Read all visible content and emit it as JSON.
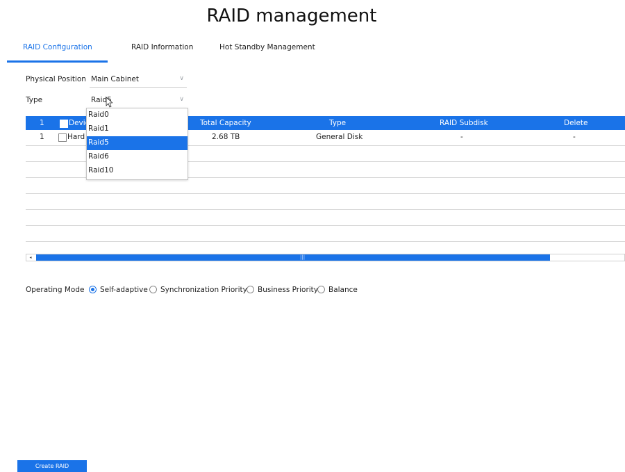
{
  "page_title": "RAID management",
  "tabs": [
    {
      "label": "RAID Configuration",
      "active": true
    },
    {
      "label": "RAID Information",
      "active": false
    },
    {
      "label": "Hot Standby Management",
      "active": false
    }
  ],
  "form": {
    "physical_position": {
      "label": "Physical Position",
      "value": "Main Cabinet"
    },
    "type": {
      "label": "Type",
      "value": "Raid5"
    }
  },
  "type_dropdown": {
    "options": [
      "Raid0",
      "Raid1",
      "Raid5",
      "Raid6",
      "Raid10"
    ],
    "selected": "Raid5"
  },
  "table": {
    "header": {
      "index": "1",
      "device": "Devic",
      "total_capacity": "Total Capacity",
      "type": "Type",
      "raid_subdisk": "RAID Subdisk",
      "delete": "Delete"
    },
    "rows": [
      {
        "index": "1",
        "device": "Hard",
        "total_capacity": "2.68 TB",
        "type": "General Disk",
        "raid_subdisk": "-",
        "delete": "-"
      }
    ],
    "scroll_left_icon": "◂",
    "scroll_grip": "|||"
  },
  "operating_mode": {
    "label": "Operating Mode",
    "options": [
      {
        "label": "Self-adaptive",
        "checked": true
      },
      {
        "label": "Synchronization Priority",
        "checked": false
      },
      {
        "label": "Business Priority",
        "checked": false
      },
      {
        "label": "Balance",
        "checked": false
      }
    ]
  },
  "create_button": "Create RAID",
  "icons": {
    "chevron": "∨",
    "accent": "#1a73e8"
  }
}
